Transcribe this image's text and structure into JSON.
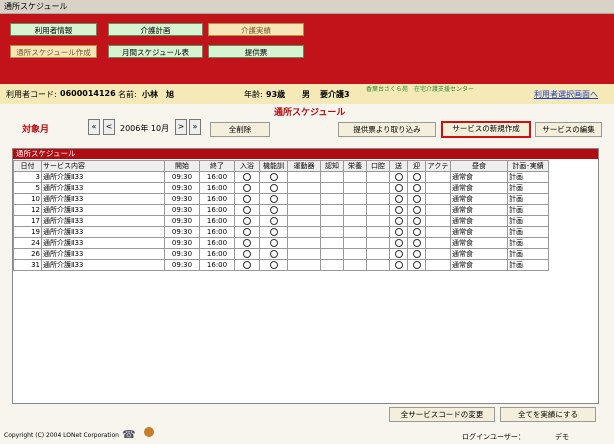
{
  "window_title": "通所スケジュール",
  "tabs_row1": [
    {
      "label": "利用者情報"
    },
    {
      "label": "介護計画"
    },
    {
      "label": "介護実績"
    }
  ],
  "tabs_row2": [
    {
      "label": "通所スケジュール作成"
    },
    {
      "label": "月間スケジュール表"
    },
    {
      "label": "提供票"
    }
  ],
  "user": {
    "code_label": "利用者コード:",
    "code": "0600014126",
    "name_label": "名前:",
    "name": "小林　旭",
    "age_label": "年齢:",
    "age": "93歳",
    "sex": "男",
    "care_level": "要介護3",
    "office": "香葉台さくら苑　在宅介護支援センター",
    "select_link": "利用者選択画面へ"
  },
  "section_title": "通所スケジュール",
  "target_month_label": "対象月",
  "nav": {
    "first": "«",
    "prev": "<",
    "next": ">",
    "last": "»"
  },
  "month_value": "2006年 10月",
  "buttons": {
    "delete_all": "全削除",
    "import_from_ticket": "提供票より取り込み",
    "new_service": "サービスの新規作成",
    "edit_service": "サービスの編集",
    "change_all_codes": "全サービスコードの変更",
    "all_to_actual": "全てを実績にする"
  },
  "table": {
    "title": "通所スケジュール",
    "columns": [
      "日付",
      "サービス内容",
      "開始",
      "終了",
      "入浴",
      "機能訓",
      "運動器",
      "認知",
      "栄養",
      "口腔",
      "送",
      "迎",
      "アクテ",
      "昼食",
      "計画･実績"
    ],
    "rows": [
      {
        "day": "3",
        "service": "通所介護Ⅱ33",
        "start": "09:30",
        "end": "16:00",
        "lunch": "通常食",
        "status": "計画"
      },
      {
        "day": "5",
        "service": "通所介護Ⅱ33",
        "start": "09:30",
        "end": "16:00",
        "lunch": "通常食",
        "status": "計画"
      },
      {
        "day": "10",
        "service": "通所介護Ⅱ33",
        "start": "09:30",
        "end": "16:00",
        "lunch": "通常食",
        "status": "計画"
      },
      {
        "day": "12",
        "service": "通所介護Ⅱ33",
        "start": "09:30",
        "end": "16:00",
        "lunch": "通常食",
        "status": "計画"
      },
      {
        "day": "17",
        "service": "通所介護Ⅱ33",
        "start": "09:30",
        "end": "16:00",
        "lunch": "通常食",
        "status": "計画"
      },
      {
        "day": "19",
        "service": "通所介護Ⅱ33",
        "start": "09:30",
        "end": "16:00",
        "lunch": "通常食",
        "status": "計画"
      },
      {
        "day": "24",
        "service": "通所介護Ⅱ33",
        "start": "09:30",
        "end": "16:00",
        "lunch": "通常食",
        "status": "計画"
      },
      {
        "day": "26",
        "service": "通所介護Ⅱ33",
        "start": "09:30",
        "end": "16:00",
        "lunch": "通常食",
        "status": "計画"
      },
      {
        "day": "31",
        "service": "通所介護Ⅱ33",
        "start": "09:30",
        "end": "16:00",
        "lunch": "通常食",
        "status": "計画"
      }
    ]
  },
  "footer": {
    "copyright": "Copyright (C) 2004 LONet Corporation",
    "login_label": "ログインユーザー：",
    "login_user": "デモ"
  },
  "colors": {
    "band": "#c2121a",
    "accent": "#b00d12",
    "info_bg": "#f6e9b8"
  }
}
